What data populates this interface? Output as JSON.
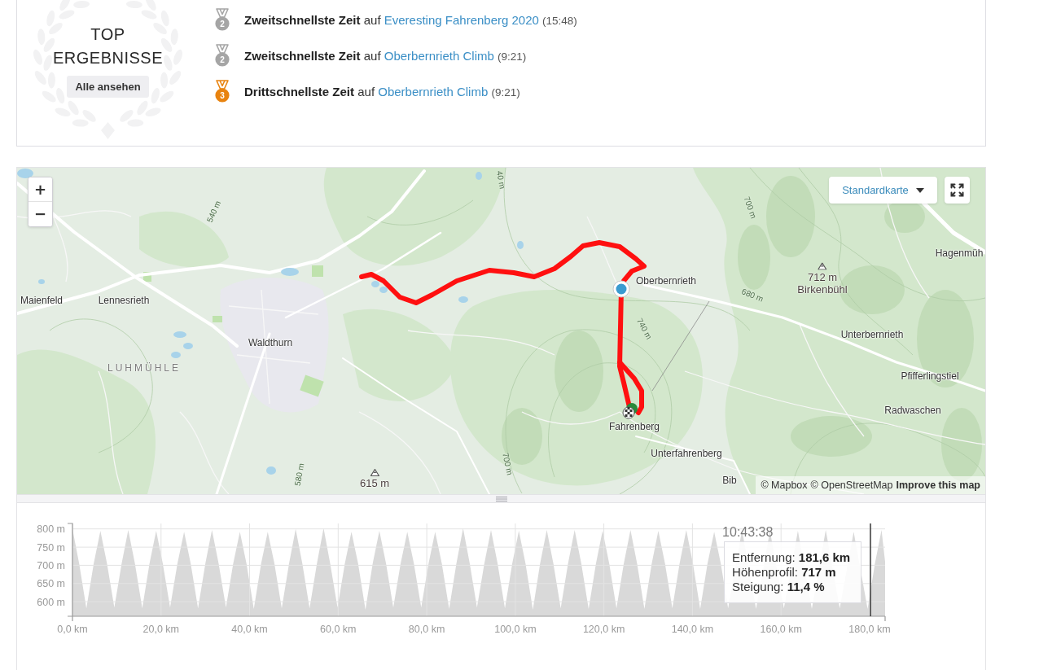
{
  "top_results": {
    "title": "TOP ERGEBNISSE",
    "view_all_button": "Alle ansehen"
  },
  "achievements": [
    {
      "rank": "2",
      "color": "#a5a5a5",
      "title": "Zweitschnellste Zeit",
      "connector": "auf",
      "segment": "Everesting Fahrenberg 2020",
      "time": "(15:48)"
    },
    {
      "rank": "2",
      "color": "#a5a5a5",
      "title": "Zweitschnellste Zeit",
      "connector": "auf",
      "segment": "Oberbernrieth Climb",
      "time": "(9:21)"
    },
    {
      "rank": "3",
      "color": "#e8830f",
      "title": "Drittschnellste Zeit",
      "connector": "auf",
      "segment": "Oberbernrieth Climb",
      "time": "(9:21)"
    }
  ],
  "map": {
    "zoom_in": "+",
    "zoom_out": "−",
    "style_picker": "Standardkarte",
    "labels": [
      {
        "kind": "contour",
        "text": "40 m"
      },
      {
        "kind": "contour",
        "text": "700 m"
      },
      {
        "kind": "contour",
        "text": "540 m"
      },
      {
        "kind": "place",
        "text": "Hagenmüh"
      },
      {
        "kind": "place",
        "text": "Oberbernrieth"
      },
      {
        "kind": "peak",
        "elevation": "712 m",
        "name": "Birkenbühl"
      },
      {
        "kind": "contour",
        "text": "680 m"
      },
      {
        "kind": "place",
        "text": "Maienfeld"
      },
      {
        "kind": "place",
        "text": "Lennesrieth"
      },
      {
        "kind": "contour",
        "text": "740 m"
      },
      {
        "kind": "place",
        "text": "Unterbernrieth"
      },
      {
        "kind": "place",
        "text": "Waldthurn"
      },
      {
        "kind": "district",
        "text": "LUHMÜHLE"
      },
      {
        "kind": "place",
        "text": "Pfifferlingstiel"
      },
      {
        "kind": "place",
        "text": "Radwaschen"
      },
      {
        "kind": "place",
        "text": "Fahrenberg"
      },
      {
        "kind": "place",
        "text": "Unterfahrenberg"
      },
      {
        "kind": "contour",
        "text": "700 m"
      },
      {
        "kind": "contour",
        "text": "580 m"
      },
      {
        "kind": "peak",
        "elevation": "615 m"
      },
      {
        "kind": "place",
        "text": "Bib"
      }
    ],
    "attribution": {
      "credits": [
        "© Mapbox",
        "© OpenStreetMap"
      ],
      "feedback_link": "Improve this map"
    }
  },
  "elevation_profile": {
    "chart_data": {
      "type": "area",
      "xlim": [
        0,
        183.5
      ],
      "ylim": [
        560,
        815
      ],
      "grid": true,
      "xticks": [
        {
          "value": 0,
          "label": "0,0 km"
        },
        {
          "value": 20,
          "label": "20,0 km"
        },
        {
          "value": 40,
          "label": "40,0 km"
        },
        {
          "value": 60,
          "label": "60,0 km"
        },
        {
          "value": 80,
          "label": "80,0 km"
        },
        {
          "value": 100,
          "label": "100,0 km"
        },
        {
          "value": 120,
          "label": "120,0 km"
        },
        {
          "value": 140,
          "label": "140,0 km"
        },
        {
          "value": 160,
          "label": "160,0 km"
        },
        {
          "value": 180,
          "label": "180,0 km"
        }
      ],
      "yticks": [
        {
          "value": 600,
          "label": "600 m"
        },
        {
          "value": 650,
          "label": "650 m"
        },
        {
          "value": 700,
          "label": "700 m"
        },
        {
          "value": 750,
          "label": "750 m"
        },
        {
          "value": 800,
          "label": "800 m"
        }
      ],
      "x": [
        0,
        1.5,
        3.15,
        4.8,
        6.3,
        7.8,
        9.45,
        11.1,
        12.6,
        14.1,
        15.75,
        17.4,
        18.9,
        20.4,
        22.05,
        23.7,
        25.2,
        26.7,
        28.35,
        30,
        31.5,
        33,
        34.65,
        36.3,
        37.8,
        39.3,
        40.95,
        42.6,
        44.1,
        45.6,
        47.25,
        48.9,
        50.4,
        51.9,
        53.55,
        55.2,
        56.7,
        58.2,
        59.85,
        61.5,
        63,
        64.5,
        66.15,
        67.8,
        69.3,
        70.8,
        72.45,
        74.1,
        75.6,
        77.1,
        78.75,
        80.4,
        81.9,
        83.4,
        85.05,
        86.7,
        88.2,
        89.7,
        91.35,
        93,
        94.5,
        96,
        97.65,
        99.3,
        100.8,
        102.3,
        103.95,
        105.6,
        107.1,
        108.6,
        110.25,
        111.9,
        113.4,
        114.9,
        116.55,
        118.2,
        119.7,
        121.2,
        122.85,
        124.5,
        126,
        127.5,
        129.15,
        130.8,
        132.3,
        133.8,
        135.45,
        137.1,
        138.6,
        140.1,
        141.75,
        143.4,
        144.9,
        146.4,
        148.05,
        149.7,
        151.2,
        152.7,
        154.35,
        156,
        157.5,
        159,
        160.65,
        162.3,
        163.8,
        165.3,
        166.95,
        168.6,
        170.1,
        171.6,
        173.25,
        174.9,
        176.4,
        177.9,
        179.55,
        181.2,
        182.7,
        183.5
      ],
      "values": [
        800,
        705,
        582,
        705,
        795,
        705,
        584,
        705,
        797,
        705,
        582,
        705,
        795,
        705,
        584,
        705,
        792,
        705,
        582,
        705,
        797,
        705,
        584,
        705,
        792,
        705,
        580,
        705,
        792,
        705,
        582,
        705,
        800,
        705,
        582,
        705,
        802,
        705,
        584,
        705,
        792,
        705,
        578,
        705,
        795,
        705,
        584,
        705,
        792,
        705,
        584,
        705,
        792,
        705,
        580,
        705,
        802,
        705,
        584,
        705,
        797,
        705,
        582,
        705,
        795,
        705,
        578,
        705,
        797,
        705,
        582,
        705,
        797,
        705,
        580,
        705,
        795,
        705,
        582,
        705,
        797,
        705,
        580,
        705,
        795,
        705,
        582,
        705,
        797,
        705,
        580,
        705,
        792,
        705,
        582,
        null,
        797,
        null,
        580,
        null,
        795,
        null,
        582,
        null,
        795,
        null,
        580,
        null,
        797,
        null,
        582,
        null,
        792,
        null,
        580,
        705,
        797,
        710
      ],
      "ref_lines": [
        {
          "axis": "x",
          "value": 180.2,
          "color": "#222222"
        }
      ]
    },
    "hover_tooltip": {
      "time": "10:43:38",
      "rows": [
        {
          "label": "Entfernung:",
          "value": "181,6 km"
        },
        {
          "label": "Höhenprofil:",
          "value": "717 m"
        },
        {
          "label": "Steigung:",
          "value": "11,4 %"
        }
      ]
    }
  }
}
